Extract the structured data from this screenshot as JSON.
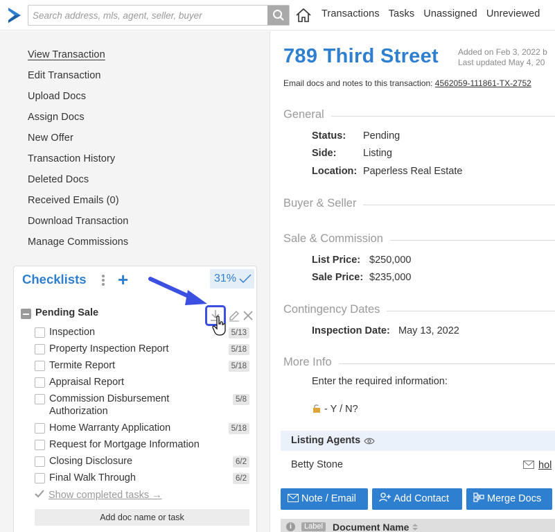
{
  "header": {
    "search_placeholder": "Search address, mls, agent, seller, buyer",
    "nav": [
      "Transactions",
      "Tasks",
      "Unassigned",
      "Unreviewed"
    ]
  },
  "sidebar": {
    "items": [
      {
        "label": "View Transaction",
        "active": true
      },
      {
        "label": "Edit Transaction"
      },
      {
        "label": "Upload Docs"
      },
      {
        "label": "Assign Docs"
      },
      {
        "label": "New Offer"
      },
      {
        "label": "Transaction History"
      },
      {
        "label": "Deleted Docs"
      },
      {
        "label": "Received Emails (0)"
      },
      {
        "label": "Download Transaction"
      },
      {
        "label": "Manage Commissions"
      }
    ]
  },
  "checklists": {
    "title": "Checklists",
    "progress": "31%",
    "group": "Pending Sale",
    "items": [
      {
        "label": "Inspection",
        "due": "5/13"
      },
      {
        "label": "Property Inspection Report",
        "due": "5/18"
      },
      {
        "label": "Termite Report",
        "due": "5/18"
      },
      {
        "label": "Appraisal Report",
        "due": ""
      },
      {
        "label": "Commission Disbursement Authorization",
        "due": "5/8"
      },
      {
        "label": "Home Warranty Application",
        "due": "5/18"
      },
      {
        "label": "Request for Mortgage Information",
        "due": ""
      },
      {
        "label": "Closing Disclosure",
        "due": "6/2"
      },
      {
        "label": "Final Walk Through",
        "due": "6/2"
      }
    ],
    "show_completed": "Show completed tasks →",
    "add_doc": "Add doc name or task"
  },
  "transaction": {
    "title": "789 Third Street",
    "added": "Added on Feb 3, 2022 b",
    "updated": "Last updated May 4, 20",
    "email_prefix": "Email docs and notes to this transaction:",
    "email_addr": "4562059-111861-TX-2752"
  },
  "general": {
    "heading": "General",
    "status_label": "Status:",
    "status": "Pending",
    "side_label": "Side:",
    "side": "Listing",
    "location_label": "Location:",
    "location": "Paperless Real Estate"
  },
  "buyer_seller": {
    "heading": "Buyer & Seller"
  },
  "sale": {
    "heading": "Sale & Commission",
    "list_label": "List Price:",
    "list_price": "$250,000",
    "sale_label": "Sale Price:",
    "sale_price": "$235,000"
  },
  "contingency": {
    "heading": "Contingency Dates",
    "inspection_label": "Inspection Date:",
    "inspection_date": "May 13, 2022"
  },
  "more_info": {
    "heading": "More Info",
    "prompt": "Enter the required information:",
    "flag": "- Y / N?"
  },
  "agents": {
    "heading": "Listing Agents",
    "name": "Betty Stone",
    "email": "hol"
  },
  "actions": {
    "note_email": "Note / Email",
    "add_contact": "Add Contact",
    "merge_docs": "Merge Docs"
  },
  "table": {
    "label_badge": "Label",
    "doc_name": "Document Name"
  },
  "colors": {
    "accent": "#2f7fd0",
    "highlight": "#3b4fe0"
  }
}
